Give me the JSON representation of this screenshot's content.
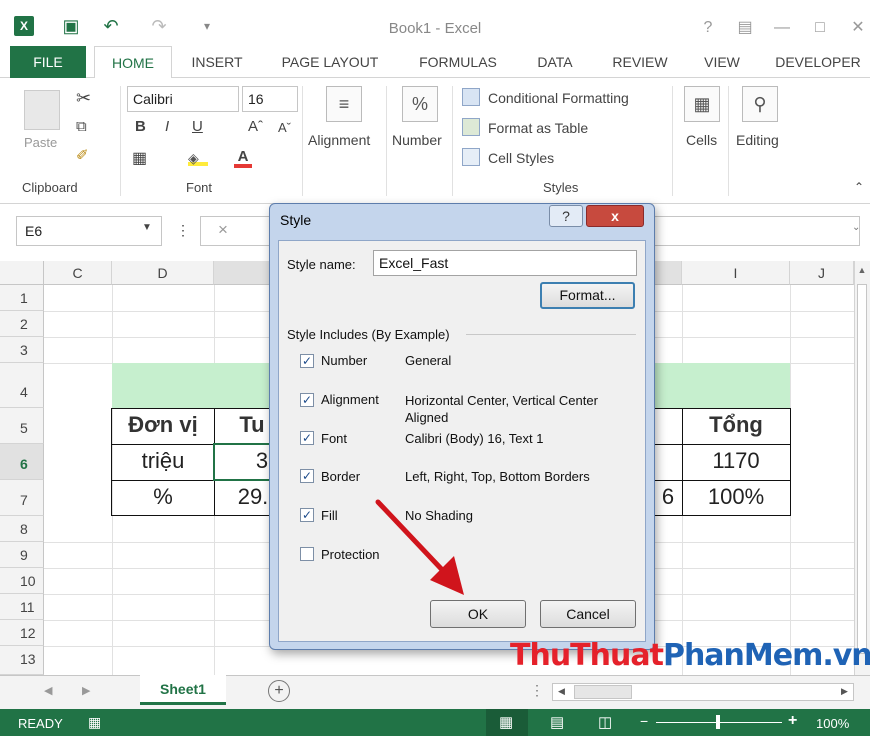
{
  "window": {
    "title": "Book1 - Excel"
  },
  "ribbon_tabs": [
    "FILE",
    "HOME",
    "INSERT",
    "PAGE LAYOUT",
    "FORMULAS",
    "DATA",
    "REVIEW",
    "VIEW",
    "DEVELOPER"
  ],
  "ribbon": {
    "clipboard": {
      "paste": "Paste",
      "label": "Clipboard"
    },
    "font": {
      "name": "Calibri",
      "size": "16",
      "label": "Font",
      "bold": "B",
      "italic": "I",
      "underline": "U"
    },
    "alignment": {
      "label": "Alignment"
    },
    "number": {
      "label": "Number",
      "icon": "%"
    },
    "styles": {
      "conditional": "Conditional Formatting",
      "format_table": "Format as Table",
      "cell_styles": "Cell Styles",
      "label": "Styles"
    },
    "cells": {
      "label": "Cells"
    },
    "editing": {
      "label": "Editing"
    }
  },
  "formula_bar": {
    "name_box": "E6",
    "cancel": "×"
  },
  "grid": {
    "columns": [
      "C",
      "D",
      "I",
      "J"
    ],
    "rows": [
      "1",
      "2",
      "3",
      "4",
      "5",
      "6",
      "7",
      "8",
      "9",
      "10",
      "11",
      "12",
      "13"
    ],
    "cells": {
      "d5": "Đơn vị",
      "e5": "Tu",
      "i5": "Tổng",
      "d6": "triệu",
      "e6": "3",
      "i6": "1170",
      "d7": "%",
      "e7": "29.",
      "h7": "6",
      "i7": "100%"
    }
  },
  "sheet_tabs": {
    "active": "Sheet1",
    "add": "+"
  },
  "status": {
    "mode": "READY",
    "zoom": "100%"
  },
  "dialog": {
    "title": "Style",
    "help": "?",
    "close": "x",
    "style_name_label": "Style name:",
    "style_name_value": "Excel_Fast",
    "format_button": "Format...",
    "includes_label": "Style Includes (By Example)",
    "items": [
      {
        "label": "Number",
        "desc": "General",
        "checked": true
      },
      {
        "label": "Alignment",
        "desc": "Horizontal Center, Vertical Center Aligned",
        "checked": true
      },
      {
        "label": "Font",
        "desc": "Calibri (Body) 16, Text 1",
        "checked": true
      },
      {
        "label": "Border",
        "desc": "Left, Right, Top, Bottom Borders",
        "checked": true
      },
      {
        "label": "Fill",
        "desc": "No Shading",
        "checked": true
      },
      {
        "label": "Protection",
        "desc": "",
        "checked": false
      }
    ],
    "ok": "OK",
    "cancel": "Cancel"
  },
  "watermark": {
    "part1": "ThuThuat",
    "part2": "PhanMem",
    "part3": ".vn"
  },
  "colors": {
    "excel_green": "#217346",
    "header_fill": "#c6efce",
    "arrow_red": "#d0141c"
  }
}
